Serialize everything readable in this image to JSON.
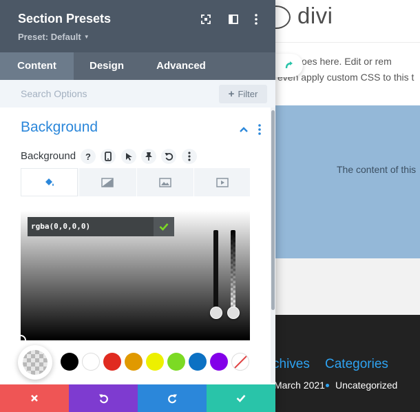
{
  "background_page": {
    "logo_text": "divi",
    "text_line1": "tent goes here. Edit or rem",
    "text_line2": "even apply custom CSS to this t",
    "blue_text": "The content of this",
    "footer_headings": [
      "chives",
      "Categories"
    ],
    "footer_items": [
      "March 2021",
      "Uncategorized"
    ]
  },
  "panel": {
    "title": "Section Presets",
    "preset_label": "Preset: Default",
    "header_icons": [
      "expand-icon",
      "split-view-icon",
      "more-vertical-icon"
    ],
    "tabs": [
      {
        "label": "Content",
        "active": true
      },
      {
        "label": "Design",
        "active": false
      },
      {
        "label": "Advanced",
        "active": false
      }
    ],
    "search": {
      "placeholder": "Search Options",
      "filter_label": "Filter"
    },
    "section": {
      "title": "Background"
    },
    "option": {
      "label": "Background",
      "icons": [
        "help-icon",
        "mobile-icon",
        "hover-pointer-icon",
        "pin-icon",
        "undo-icon",
        "more-vertical-icon"
      ]
    },
    "bg_type_tabs": [
      "paint-bucket-icon",
      "gradient-icon",
      "image-icon",
      "video-icon"
    ],
    "color_picker": {
      "value": "rgba(0,0,0,0)"
    },
    "swatches": [
      {
        "name": "black",
        "color": "#000000"
      },
      {
        "name": "white",
        "color": "#ffffff"
      },
      {
        "name": "red",
        "color": "#e02b20"
      },
      {
        "name": "orange",
        "color": "#e09900"
      },
      {
        "name": "yellow",
        "color": "#edf000"
      },
      {
        "name": "green",
        "color": "#7cda24"
      },
      {
        "name": "blue",
        "color": "#0c71c3"
      },
      {
        "name": "purple",
        "color": "#8300e9"
      }
    ],
    "footer_buttons": [
      {
        "name": "cancel",
        "color": "#ef5555"
      },
      {
        "name": "undo",
        "color": "#7e3bd0"
      },
      {
        "name": "redo",
        "color": "#2b87da"
      },
      {
        "name": "save",
        "color": "#29c4a9"
      }
    ]
  }
}
